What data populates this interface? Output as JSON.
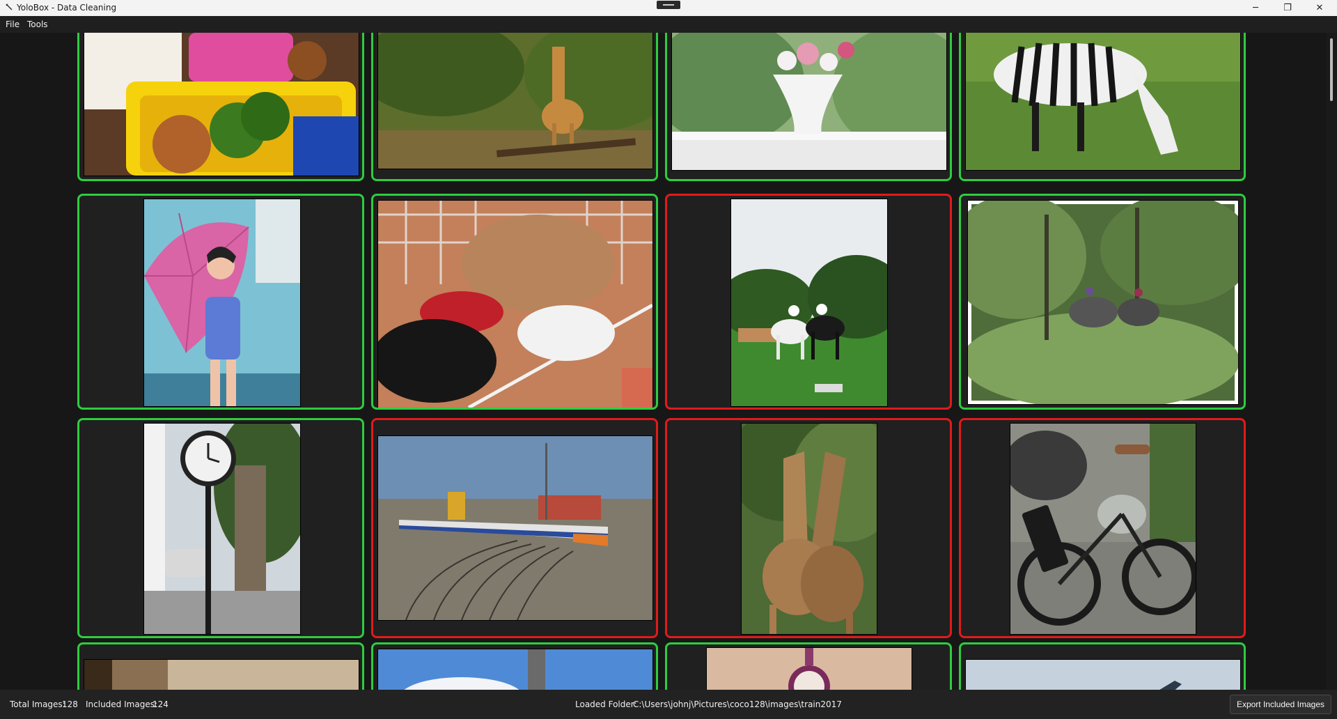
{
  "window": {
    "title": "YoloBox - Data Cleaning",
    "controls": {
      "minimize": "─",
      "maximize": "❐",
      "close": "✕"
    }
  },
  "menu": {
    "items": [
      "File",
      "Tools"
    ]
  },
  "grid": {
    "rows": [
      [
        {
          "included": true,
          "icon": "lunchbox-image"
        },
        {
          "included": true,
          "icon": "giraffe-image"
        },
        {
          "included": true,
          "icon": "flower-vase-image"
        },
        {
          "included": true,
          "icon": "zebra-image"
        }
      ],
      [
        {
          "included": true,
          "icon": "umbrella-woman-image"
        },
        {
          "included": true,
          "icon": "dog-shoes-image"
        },
        {
          "included": false,
          "icon": "horses-riders-image"
        },
        {
          "included": true,
          "icon": "jungle-elephants-image"
        }
      ],
      [
        {
          "included": true,
          "icon": "street-clock-image"
        },
        {
          "included": false,
          "icon": "train-yard-image"
        },
        {
          "included": false,
          "icon": "giraffes-image"
        },
        {
          "included": false,
          "icon": "motorcycles-image"
        }
      ],
      [
        {
          "included": true,
          "icon": "street-image"
        },
        {
          "included": true,
          "icon": "sky-birds-image"
        },
        {
          "included": true,
          "icon": "clock-image"
        },
        {
          "included": true,
          "icon": "airplane-image"
        }
      ]
    ]
  },
  "status": {
    "total_label": "Total Images:",
    "total_value": "128",
    "included_label": "Included Images:",
    "included_value": "124",
    "folder_label": "Loaded Folder:",
    "folder_path": "C:\\Users\\johnj\\Pictures\\coco128\\images\\train2017",
    "export_label": "Export Included Images"
  },
  "colors": {
    "included": "#2ecc40",
    "excluded": "#e01b1b",
    "background": "#171717",
    "card": "#202020"
  }
}
